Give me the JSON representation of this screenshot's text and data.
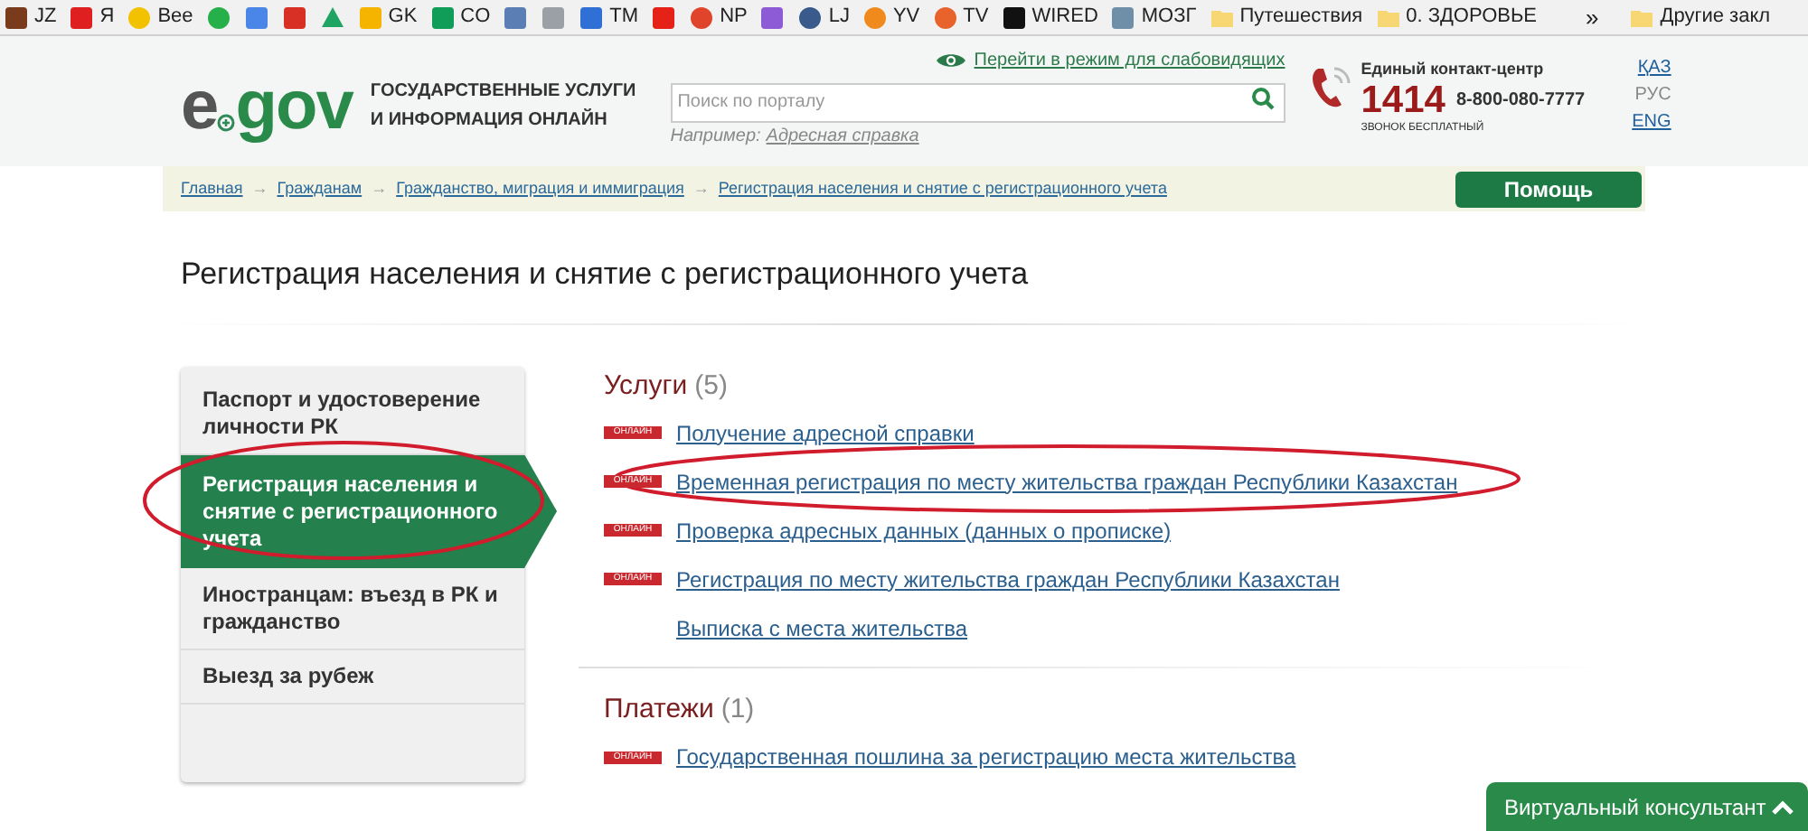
{
  "bookmarks": [
    {
      "label": "JZ",
      "kind": "square",
      "color": "#7a3b1c"
    },
    {
      "label": "Я",
      "kind": "square",
      "color": "#e02020"
    },
    {
      "label": "Bee",
      "kind": "round",
      "color": "#f2c200"
    },
    {
      "kind": "round",
      "color": "#25b04a"
    },
    {
      "kind": "square",
      "color": "#4a86e8"
    },
    {
      "kind": "square",
      "color": "#d93025"
    },
    {
      "kind": "triangle",
      "color": "#1fa463"
    },
    {
      "label": "GK",
      "kind": "square",
      "color": "#f4b400"
    },
    {
      "label": "CO",
      "kind": "square",
      "color": "#0f9d58"
    },
    {
      "kind": "square",
      "color": "#5b7fb5"
    },
    {
      "kind": "square",
      "color": "#9aa0a6"
    },
    {
      "label": "TM",
      "kind": "square",
      "color": "#2f6fd6"
    },
    {
      "kind": "square",
      "color": "#e62117"
    },
    {
      "label": "NP",
      "kind": "round",
      "color": "#e0442b"
    },
    {
      "kind": "square",
      "color": "#8e5bd6"
    },
    {
      "label": "LJ",
      "kind": "round",
      "color": "#3a5a8c"
    },
    {
      "label": "YV",
      "kind": "round",
      "color": "#f08a1c"
    },
    {
      "label": "TV",
      "kind": "round",
      "color": "#e8632c"
    },
    {
      "label": "WIRED",
      "kind": "square",
      "color": "#111111"
    },
    {
      "label": "МОЗГ",
      "kind": "square",
      "color": "#6f8fa8"
    },
    {
      "label": "Путешествия",
      "kind": "folder",
      "color": "#f7d774"
    },
    {
      "label": "0. ЗДОРОВЬЕ",
      "kind": "folder",
      "color": "#f7d774"
    }
  ],
  "bookmarks_more": "»",
  "bookmarks_other": "Другие закл",
  "header": {
    "logo_left": "e",
    "logo_right": "gov",
    "tagline": [
      "ГОСУДАРСТВЕННЫЕ УСЛУГИ",
      "И ИНФОРМАЦИЯ ОНЛАЙН"
    ],
    "accessibility_link": "Перейти в режим для слабовидящих",
    "search": {
      "placeholder": "Поиск по порталу"
    },
    "example_label": "Например:",
    "example_link": "Адресная справка",
    "contact_title": "Единый контакт-центр",
    "short_number": "1414",
    "phone": "8-800-080-7777",
    "free_call": "ЗВОНОК БЕСПЛАТНЫЙ",
    "languages": [
      {
        "label": "ҚАЗ",
        "selected": false
      },
      {
        "label": "РУС",
        "selected": true
      },
      {
        "label": "ENG",
        "selected": false
      }
    ]
  },
  "breadcrumbs": [
    "Главная",
    "Гражданам",
    "Гражданство, миграция и иммиграция",
    "Регистрация населения и снятие с регистрационного учета"
  ],
  "breadcrumb_separator": "→",
  "help_button": "Помощь",
  "page_title": "Регистрация населения и снятие с регистрационного учета",
  "sidebar": {
    "items": [
      {
        "label": "Паспорт и удостоверение личности РК",
        "selected": false
      },
      {
        "label": "Регистрация населения и снятие с регистрационного учета",
        "selected": true
      },
      {
        "label": "Иностранцам: въезд в РК и гражданство",
        "selected": false
      },
      {
        "label": "Выезд за рубеж",
        "selected": false
      }
    ]
  },
  "sections": [
    {
      "title": "Услуги",
      "count": "(5)",
      "items": [
        {
          "label": "Получение адресной справки",
          "badge": "ОНЛАЙН"
        },
        {
          "label": "Временная регистрация по месту жительства граждан Республики Казахстан",
          "badge": "ОНЛАЙН"
        },
        {
          "label": "Проверка адресных данных (данных о прописке)",
          "badge": "ОНЛАЙН"
        },
        {
          "label": "Регистрация по месту жительства граждан Республики Казахстан",
          "badge": "ОНЛАЙН"
        },
        {
          "label": "Выписка с места жительства"
        }
      ]
    },
    {
      "title": "Платежи",
      "count": "(1)",
      "items": [
        {
          "label": "Государственная пошлина за регистрацию места жительства",
          "badge": "ОНЛАЙН"
        }
      ]
    }
  ],
  "consultant": {
    "label": "Виртуальный консультант",
    "expanded": false
  }
}
